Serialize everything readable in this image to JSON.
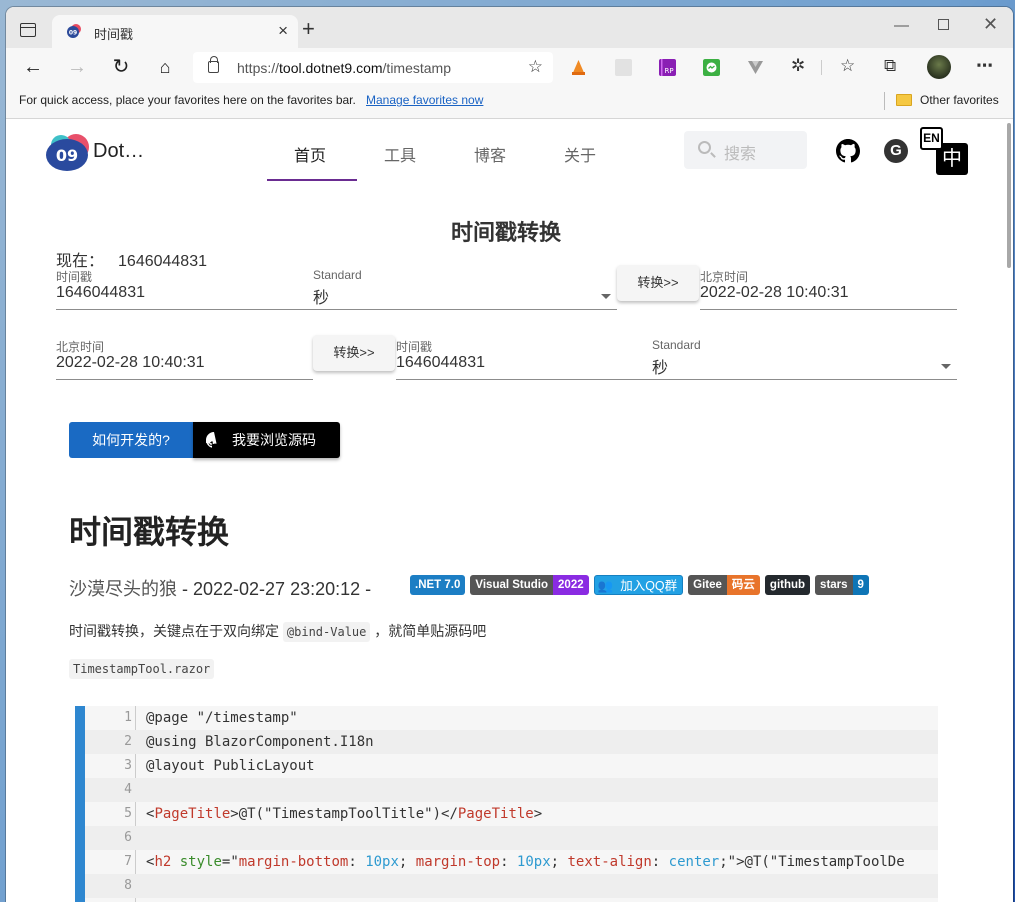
{
  "browser": {
    "tab_title": "时间戳",
    "url_prefix": "https://",
    "url_host": "tool.dotnet9.com",
    "url_path": "/timestamp",
    "favorites_bar_text": "For quick access, place your favorites here on the favorites bar.",
    "manage_favorites_link": "Manage favorites now",
    "other_favorites": "Other favorites",
    "new_tab_symbol": "+",
    "close_symbol": "×"
  },
  "site": {
    "brand": "Dot…",
    "nav": [
      {
        "label": "首页",
        "active": true
      },
      {
        "label": "工具",
        "active": false
      },
      {
        "label": "博客",
        "active": false
      },
      {
        "label": "关于",
        "active": false
      }
    ],
    "search_placeholder": "搜索",
    "lang_en": "EN",
    "lang_zh": "中",
    "gitee_glyph": "G"
  },
  "tool": {
    "title": "时间戳转换",
    "now_label": "现在：",
    "now_value": "1646044831",
    "row1": {
      "timestamp_label": "时间戳",
      "timestamp_value": "1646044831",
      "unit_label": "Standard",
      "unit_value": "秒",
      "convert_button": "转换>>",
      "result_label": "北京时间",
      "result_value": "2022-02-28 10:40:31"
    },
    "row2": {
      "datetime_label": "北京时间",
      "datetime_value": "2022-02-28 10:40:31",
      "convert_button": "转换>>",
      "result_label": "时间戳",
      "result_value": "1646044831",
      "unit_label": "Standard",
      "unit_value": "秒"
    },
    "how_button": "如何开发的?",
    "source_button": "我要浏览源码"
  },
  "article": {
    "title": "时间戳转换",
    "author": "沙漠尽头的狼",
    "date_text": " - 2022-02-27 23:20:12 - ",
    "badges": [
      {
        "left": ".NET 7.0",
        "right": null,
        "left_color": "#1c7ec4",
        "right_color": null
      },
      {
        "left": "Visual Studio",
        "right": "2022",
        "left_color": "#555555",
        "right_color": "#8a2be2"
      },
      {
        "left": "加入QQ群",
        "right": null,
        "left_color": "#22a1e4",
        "right_color": null
      },
      {
        "left": "Gitee",
        "right": "码云",
        "left_color": "#555555",
        "right_color": "#e8742b"
      },
      {
        "left": "github",
        "right": null,
        "left_color": "#24292e",
        "right_color": null
      },
      {
        "left": "stars",
        "right": "9",
        "left_color": "#555555",
        "right_color": "#0e75b6"
      }
    ],
    "desc_before": "时间戳转换，关键点在于双向绑定",
    "desc_code": "@bind-Value",
    "desc_after": "，就简单贴源码吧",
    "filename": "TimestampTool.razor",
    "code_lines": [
      {
        "n": "1",
        "text": "@page \"/timestamp\""
      },
      {
        "n": "2",
        "text": "@using BlazorComponent.I18n"
      },
      {
        "n": "3",
        "text": "@layout PublicLayout"
      },
      {
        "n": "4",
        "text": ""
      },
      {
        "n": "5",
        "text": "<PageTitle>@T(\"TimestampToolTitle\")</PageTitle>"
      },
      {
        "n": "6",
        "text": ""
      },
      {
        "n": "7",
        "text": "<h2 style=\"margin-bottom: 10px; margin-top: 10px; text-align: center;\">@T(\"TimestampToolDe"
      },
      {
        "n": "8",
        "text": ""
      }
    ]
  },
  "colors": {
    "nav_active_underline": "#6a2c91",
    "primary_button": "#1a6ac3",
    "code_accent": "#2e87d0"
  }
}
